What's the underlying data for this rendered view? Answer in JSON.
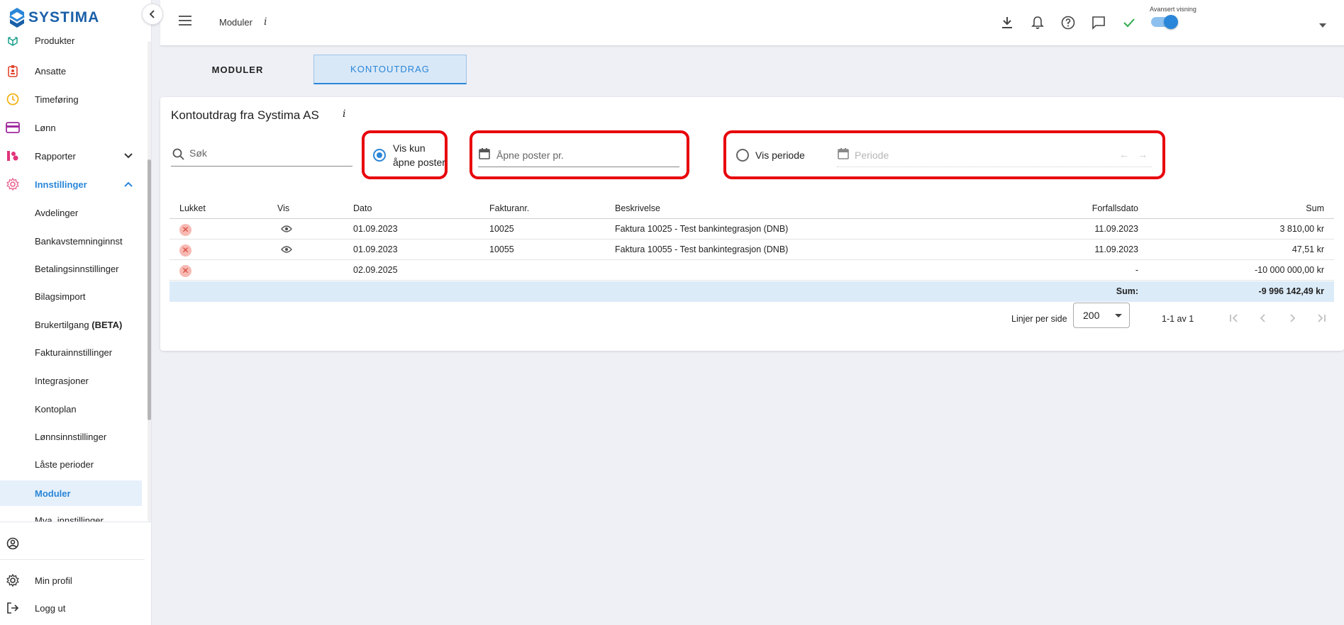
{
  "brand": {
    "name": "SYSTIMA"
  },
  "sidebar": {
    "items": [
      {
        "label": "Produkter",
        "icon": "cube-icon"
      },
      {
        "label": "Ansatte",
        "icon": "badge-icon"
      },
      {
        "label": "Timeføring",
        "icon": "clock-icon"
      },
      {
        "label": "Lønn",
        "icon": "card-icon"
      },
      {
        "label": "Rapporter",
        "icon": "chart-icon"
      },
      {
        "label": "Innstillinger",
        "icon": "gear-icon"
      }
    ],
    "sub_items": [
      "Avdelinger",
      "Bankavstemninginnst",
      "Betalingsinnstillinger",
      "Bilagsimport",
      "Brukertilgang",
      "Fakturainnstillinger",
      "Integrasjoner",
      "Kontoplan",
      "Lønnsinnstillinger",
      "Låste perioder",
      "Moduler",
      "Mva_innstillinger"
    ],
    "beta_tag": "(BETA)",
    "bottom": {
      "profile": "Min profil",
      "logout": "Logg ut"
    }
  },
  "topbar": {
    "breadcrumb": "Moduler",
    "info": "i",
    "advanced_label": "Avansert visning",
    "advanced_on": true
  },
  "tabs": [
    {
      "label": "MODULER",
      "active": false
    },
    {
      "label": "KONTOUTDRAG",
      "active": true
    }
  ],
  "statement": {
    "title": "Kontoutdrag fra Systima AS",
    "info": "i",
    "search_placeholder": "Søk",
    "open_only_label": "Vis kun åpne poster",
    "open_date_placeholder": "Åpne poster pr.",
    "period_label": "Vis periode",
    "period_placeholder": "Periode",
    "prev_arrow": "←",
    "next_arrow": "→"
  },
  "table": {
    "headers": [
      "Lukket",
      "Vis",
      "Dato",
      "Fakturanr.",
      "Beskrivelse",
      "Forfallsdato",
      "Sum"
    ],
    "rows": [
      {
        "date": "01.09.2023",
        "invoice": "10025",
        "description": "Faktura 10025 - Test bankintegrasjon (DNB)",
        "due": "11.09.2023",
        "sum": "3 810,00 kr",
        "has_view": true
      },
      {
        "date": "01.09.2023",
        "invoice": "10055",
        "description": "Faktura 10055 - Test bankintegrasjon (DNB)",
        "due": "11.09.2023",
        "sum": "47,51 kr",
        "has_view": true
      },
      {
        "date": "02.09.2025",
        "invoice": "",
        "description": "",
        "due": "-",
        "sum": "-10 000 000,00 kr",
        "has_view": false
      }
    ],
    "sum_label": "Sum:",
    "sum_total": "-9 996 142,49 kr"
  },
  "pagination": {
    "rows_per_page_label": "Linjer per side",
    "rows_per_page": "200",
    "range": "1-1 av 1"
  },
  "colors": {
    "accent": "#2a86d8",
    "highlight": "#e8000b",
    "sum_row": "#dcebf8"
  }
}
